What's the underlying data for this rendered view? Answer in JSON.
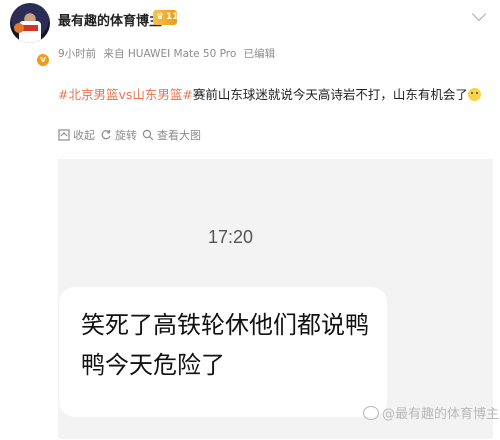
{
  "author": {
    "name": "最有趣的体育博主",
    "level": "11",
    "verified": true,
    "meta": {
      "time": "9小时前",
      "source": "来自 HUAWEI Mate 50 Pro",
      "edited": "已编辑"
    }
  },
  "post": {
    "tag1": "#北京男篮vs山东男篮#",
    "text": "赛前山东球迷就说今天高诗岩不打，山东有机会了",
    "emoji": "smile-emoji"
  },
  "actions": {
    "collapse": "收起",
    "rotate": "旋转",
    "view_large": "查看大图"
  },
  "screenshot": {
    "time": "17:20",
    "message": "笑死了高铁轮休他们都说鸭鸭今天危险了",
    "watermark": "@最有趣的体育博主"
  },
  "colors": {
    "accent": "#eb7350",
    "badge": "#f19b1c",
    "muted": "#8c8c8c",
    "card_bg": "#f3f3f3"
  }
}
